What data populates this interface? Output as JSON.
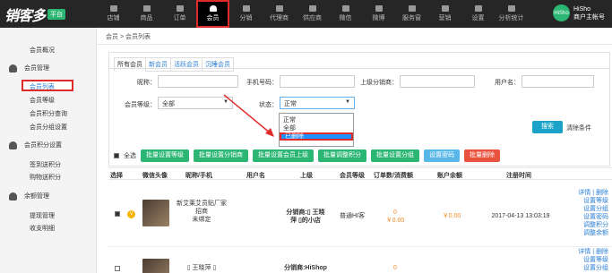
{
  "brand": {
    "logo": "销客多",
    "tag": "平台"
  },
  "nav": [
    {
      "label": "店铺"
    },
    {
      "label": "商品"
    },
    {
      "label": "订单"
    },
    {
      "label": "会员"
    },
    {
      "label": "分销"
    },
    {
      "label": "代理商"
    },
    {
      "label": "供应商"
    },
    {
      "label": "微信"
    },
    {
      "label": "微博"
    },
    {
      "label": "服务窗"
    },
    {
      "label": "营销"
    },
    {
      "label": "设置"
    },
    {
      "label": "分析统计"
    }
  ],
  "nav_active": "会员",
  "user": {
    "avatar": "HiSho",
    "name": "HiSho",
    "role": "商户主帐号"
  },
  "sidebar": {
    "members_overview": "会员概况",
    "member_management": "会员管理",
    "items": [
      "会员列表",
      "会员等级",
      "会员积分查询",
      "会员分组设置"
    ],
    "points_management": "会员积分设置",
    "points": [
      "签到送积分",
      "购物送积分"
    ],
    "balance_management": "余额管理",
    "balance": [
      "提现管理",
      "收支明细"
    ]
  },
  "breadcrumb": "会员 > 会员列表",
  "tabs": [
    "所有会员",
    "新会员",
    "活跃会员",
    "沉睡会员"
  ],
  "filters": {
    "nickname_label": "昵称：",
    "nickname": "",
    "phone_label": "手机号码：",
    "phone": "",
    "parent_label": "上级分销商：",
    "parent": "",
    "username_label": "用户名：",
    "username": "",
    "level_label": "会员等级：",
    "level": "全部",
    "status_label": "状态：",
    "status": "正常",
    "status_options": [
      "正常",
      "全部",
      "已删除"
    ]
  },
  "search_button": "搜索",
  "clear_link": "清除条件",
  "select_all": "全选",
  "bulk_actions": [
    {
      "label": "批量设置等级",
      "color": "#2bb673"
    },
    {
      "label": "批量设置分销商",
      "color": "#2bb673"
    },
    {
      "label": "批量设置会员上级",
      "color": "#2bb673"
    },
    {
      "label": "批量调整积分",
      "color": "#2bb673"
    },
    {
      "label": "批量设置分组",
      "color": "#2bb673"
    },
    {
      "label": "设置密码",
      "color": "#59b7e8"
    },
    {
      "label": "批量删除",
      "color": "#e9533d"
    }
  ],
  "table": {
    "headers": [
      "选择",
      "微信头像",
      "昵称/手机",
      "用户名",
      "上级",
      "会员等级",
      "订单数/消费额",
      "账户余额",
      "注册时间"
    ],
    "rows": [
      {
        "nick": [
          "新艾莱艾员贴厂家",
          "招商",
          "未绑定"
        ],
        "parent": [
          "分销商:▯ 王晓",
          "萍 ▯的小店"
        ],
        "level": "普通HI客",
        "orders": "0",
        "spent": "￥0.00",
        "balance": "￥0.00",
        "registered": "2017-04-13 13:03:19",
        "ops": [
          "详情 | 删除",
          "设置等级",
          "设置分组",
          "设置密码",
          "调整积分",
          "调整余额"
        ]
      },
      {
        "nick": [
          "▯ 王晓萍 ▯",
          ""
        ],
        "parent": [
          "分销商:HiShop",
          ""
        ],
        "level": "",
        "orders": "0",
        "spent": "",
        "balance": "",
        "registered": "",
        "ops": [
          "详情 | 删除",
          "设置等级",
          "设置分组"
        ]
      }
    ]
  }
}
